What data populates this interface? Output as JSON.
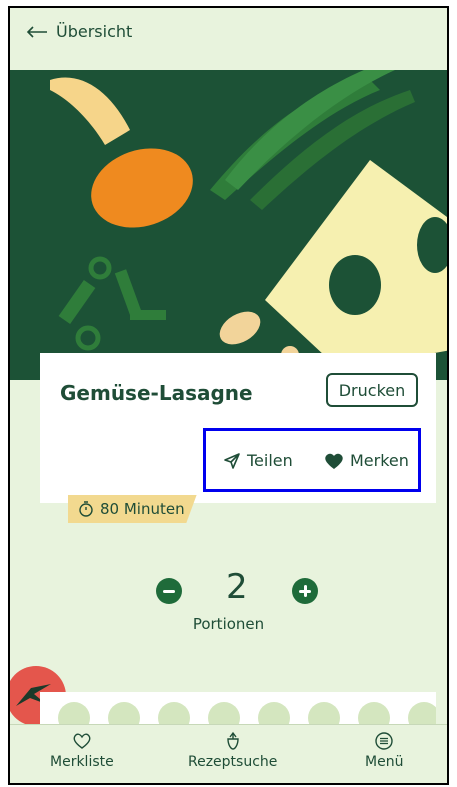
{
  "header": {
    "back_label": "Übersicht"
  },
  "recipe": {
    "title": "Gemüse-Lasagne",
    "print_label": "Drucken",
    "share_label": "Teilen",
    "save_label": "Merken",
    "duration": "80 Minuten"
  },
  "portions": {
    "count": "2",
    "label": "Portionen"
  },
  "nav": {
    "items": [
      {
        "label": "Merkliste",
        "icon": "heart-outline-icon"
      },
      {
        "label": "Rezeptsuche",
        "icon": "vegetable-icon"
      },
      {
        "label": "Menü",
        "icon": "menu-icon"
      }
    ]
  },
  "colors": {
    "brand_green": "#1f4d37",
    "hero_green": "#1c5236",
    "background": "#e8f3dd",
    "highlight": "#0000ee"
  }
}
